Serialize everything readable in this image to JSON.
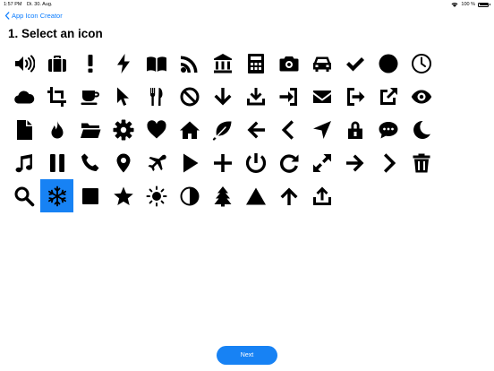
{
  "status_bar": {
    "time": "1:57 PM",
    "date": "Di. 30. Aug.",
    "battery": "100 %"
  },
  "nav": {
    "back_label": "App Icon Creator"
  },
  "page": {
    "title": "1. Select an icon"
  },
  "icons": [
    "volume-icon",
    "briefcase-icon",
    "exclamation-icon",
    "bolt-icon",
    "book-icon",
    "rss-icon",
    "bank-icon",
    "calculator-icon",
    "camera-icon",
    "car-icon",
    "checkmark-icon",
    "circle-icon",
    "clock-icon",
    "cloud-icon",
    "crop-icon",
    "coffee-icon",
    "cursor-icon",
    "cutlery-icon",
    "ban-icon",
    "arrow-down-icon",
    "download-icon",
    "sign-in-icon",
    "envelope-icon",
    "sign-out-icon",
    "external-link-icon",
    "eye-icon",
    "file-icon",
    "fire-icon",
    "folder-icon",
    "gear-icon",
    "heart-icon",
    "home-icon",
    "leaf-icon",
    "arrow-left-icon",
    "chevron-left-icon",
    "location-arrow-icon",
    "lock-icon",
    "chat-bubble-icon",
    "moon-icon",
    "music-icon",
    "pause-icon",
    "phone-icon",
    "map-pin-icon",
    "airplane-icon",
    "play-icon",
    "plus-icon",
    "power-icon",
    "refresh-icon",
    "expand-icon",
    "arrow-right-icon",
    "chevron-right-icon",
    "trash-icon",
    "search-icon",
    "snowflake-icon",
    "stop-icon",
    "star-icon",
    "sun-icon",
    "contrast-icon",
    "tree-icon",
    "triangle-icon",
    "arrow-up-icon",
    "share-icon"
  ],
  "selected_icon": "snowflake-icon",
  "footer": {
    "next_label": "Next"
  },
  "colors": {
    "accent": "#1782f4",
    "link": "#0a7cff"
  }
}
